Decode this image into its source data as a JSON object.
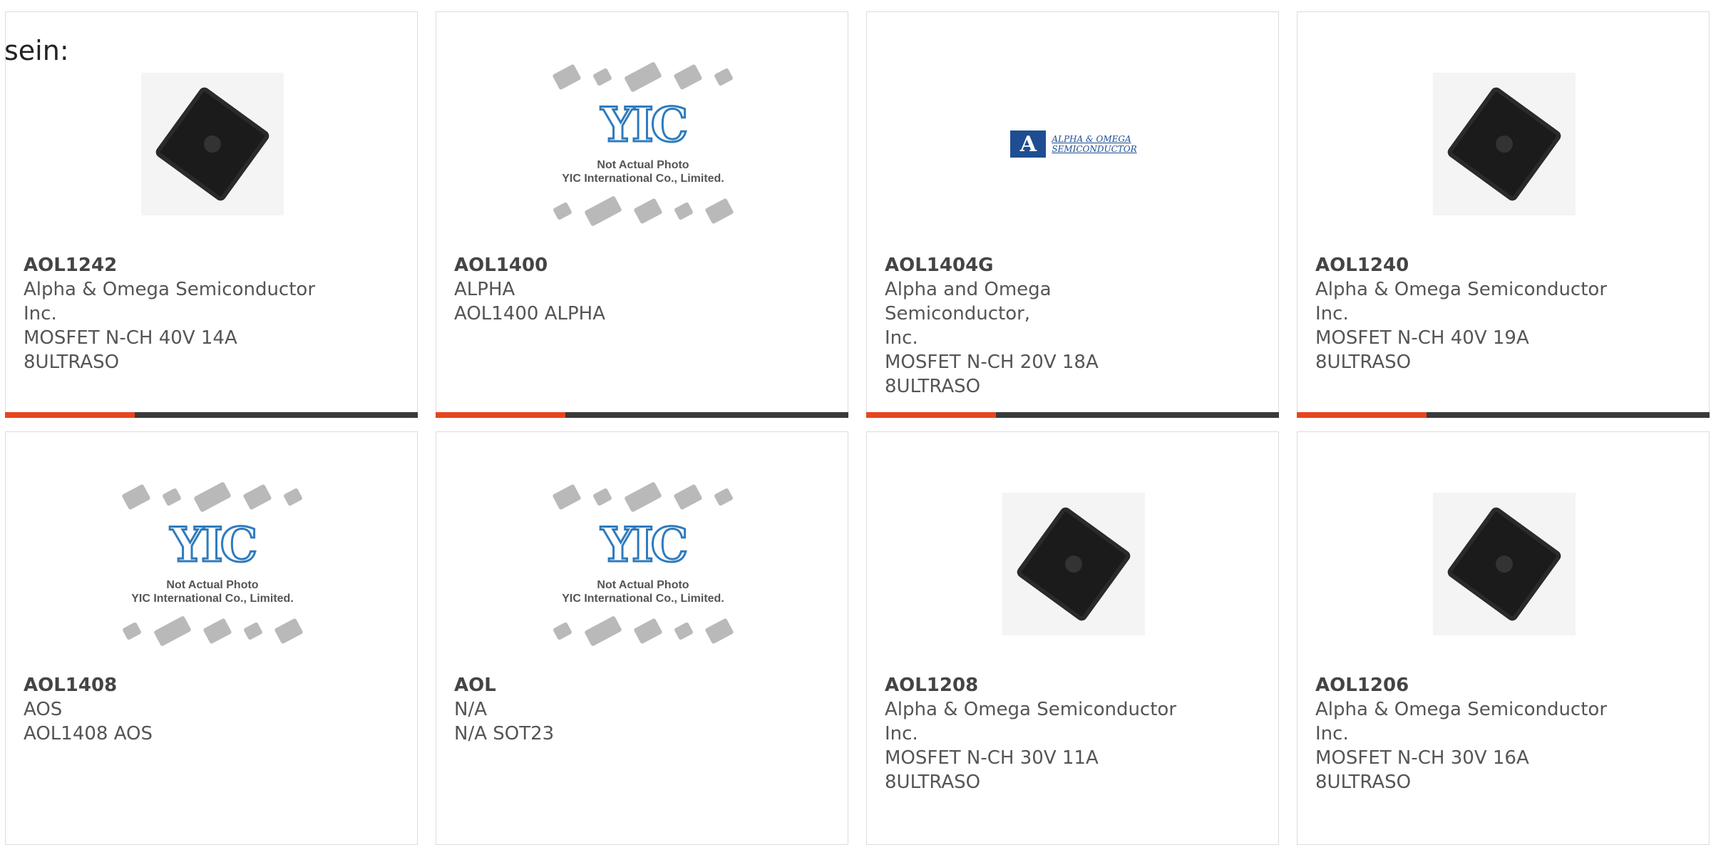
{
  "intro_text": "sein:",
  "placeholder": {
    "logo_text": "YIC",
    "caption_line1": "Not Actual Photo",
    "caption_line2": "YIC International Co., Limited."
  },
  "brand_logo": {
    "line1": "ALPHA & OMEGA",
    "line2": "SEMICONDUCTOR"
  },
  "colors": {
    "accent": "#e8451e",
    "bar": "#3a3a3a"
  },
  "products": [
    {
      "part": "AOL1242",
      "lines": [
        "Alpha & Omega Semiconductor",
        "Inc.",
        "MOSFET N-CH 40V 14A",
        "8ULTRASO"
      ],
      "image": "chip"
    },
    {
      "part": "AOL1400",
      "lines": [
        "ALPHA",
        "AOL1400 ALPHA"
      ],
      "image": "placeholder"
    },
    {
      "part": "AOL1404G",
      "lines": [
        "Alpha and Omega Semiconductor,",
        "Inc.",
        "MOSFET N-CH 20V 18A",
        "8ULTRASO"
      ],
      "image": "brand-logo"
    },
    {
      "part": "AOL1240",
      "lines": [
        "Alpha & Omega Semiconductor",
        "Inc.",
        "MOSFET N-CH 40V 19A",
        "8ULTRASO"
      ],
      "image": "chip"
    },
    {
      "part": "AOL1408",
      "lines": [
        "AOS",
        "AOL1408 AOS"
      ],
      "image": "placeholder"
    },
    {
      "part": "AOL",
      "lines": [
        "N/A",
        "N/A SOT23"
      ],
      "image": "placeholder"
    },
    {
      "part": "AOL1208",
      "lines": [
        "Alpha & Omega Semiconductor",
        "Inc.",
        "MOSFET N-CH 30V 11A",
        "8ULTRASO"
      ],
      "image": "chip"
    },
    {
      "part": "AOL1206",
      "lines": [
        "Alpha & Omega Semiconductor",
        "Inc.",
        "MOSFET N-CH 30V 16A",
        "8ULTRASO"
      ],
      "image": "chip"
    }
  ]
}
